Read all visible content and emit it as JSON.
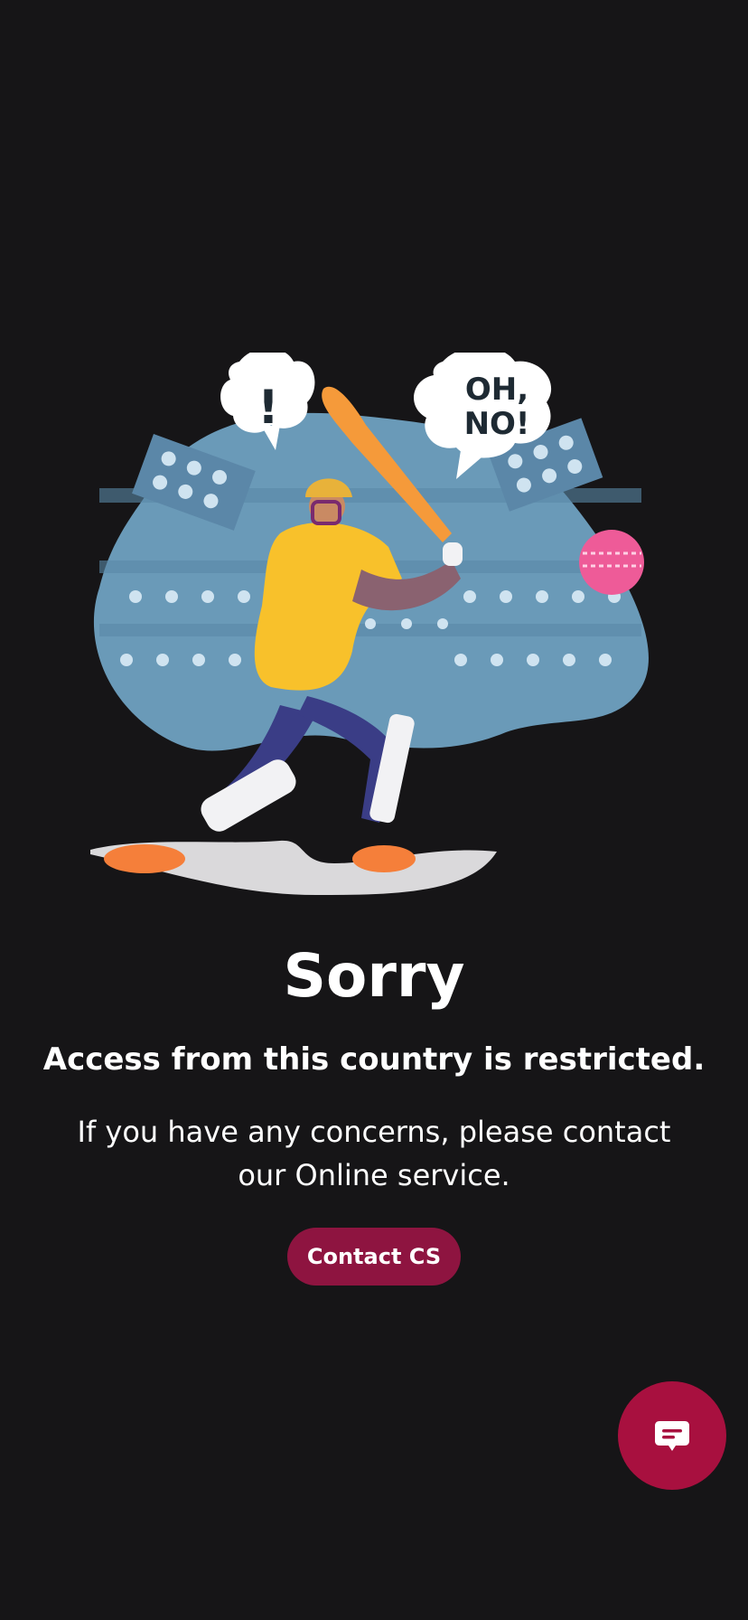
{
  "illustration": {
    "bubble_left_text": "!",
    "bubble_right_line1": "OH,",
    "bubble_right_line2": "NO!"
  },
  "main": {
    "title": "Sorry",
    "subtitle": "Access from this country is restricted.",
    "message": "If you have any concerns, please contact our Online service.",
    "contact_button_label": "Contact CS"
  },
  "icons": {
    "chat": "chat-bubble-icon"
  },
  "colors": {
    "background": "#161517",
    "accent": "#8e1440",
    "fab": "#a8103f",
    "stadium": "#6a9ab8"
  }
}
